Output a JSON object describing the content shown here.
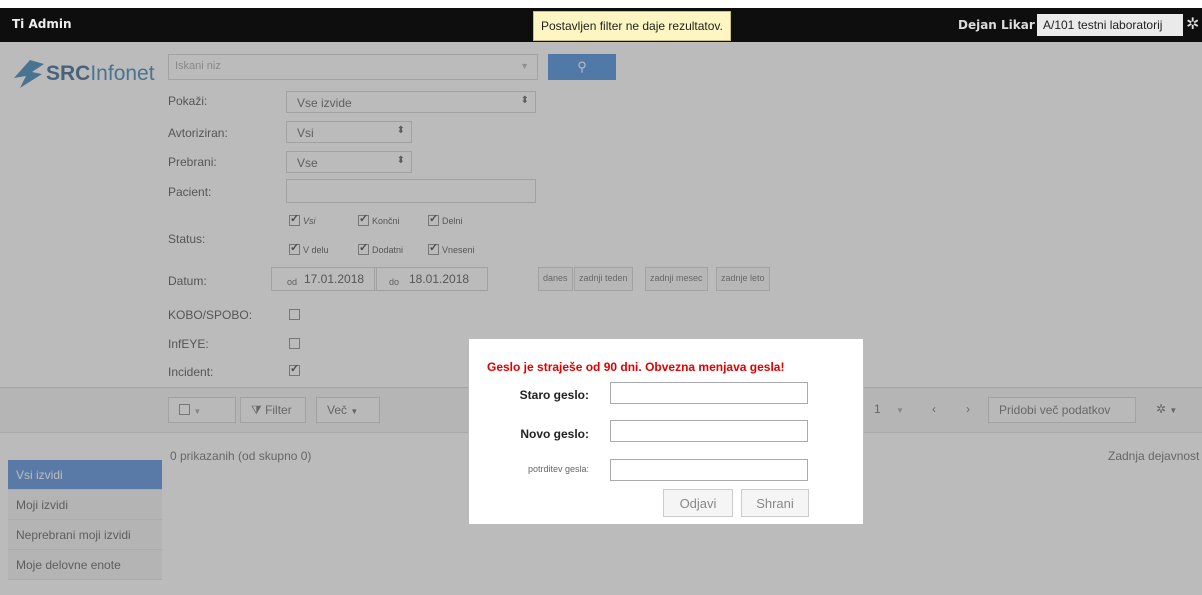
{
  "topbar": {
    "brand": "Ti  Admin",
    "user": "Dejan Likar",
    "lab": "A/101 testni laboratorij",
    "gear_icon": "gear-icon"
  },
  "tooltip": "Postavljen filter ne daje rezultatov.",
  "logo": {
    "strong": "SRC",
    "rest": "Infonet"
  },
  "search": {
    "placeholder": "Iskani niz",
    "button_icon": "search-icon"
  },
  "filters": {
    "pokazi": {
      "label": "Pokaži:",
      "value": "Vse izvide"
    },
    "avtoriziran": {
      "label": "Avtoriziran:",
      "value": "Vsi"
    },
    "prebrani": {
      "label": "Prebrani:",
      "value": "Vse"
    },
    "pacient": {
      "label": "Pacient:",
      "value": ""
    },
    "status": {
      "label": "Status:",
      "options": [
        {
          "label": "Vsi",
          "checked": true
        },
        {
          "label": "Končni",
          "checked": true
        },
        {
          "label": "Delni",
          "checked": true
        },
        {
          "label": "V delu",
          "checked": true
        },
        {
          "label": "Dodatni",
          "checked": true
        },
        {
          "label": "Vneseni",
          "checked": true
        }
      ]
    },
    "datum": {
      "label": "Datum:",
      "od_label": "od",
      "od_value": "17.01.2018",
      "do_label": "do",
      "do_value": "18.01.2018",
      "quick": [
        "danes",
        "zadnji teden",
        "zadnji mesec",
        "zadnje leto"
      ]
    },
    "kobo": {
      "label": "KOBO/SPOBO:",
      "checked": false
    },
    "infeye": {
      "label": "InfEYE:",
      "checked": false
    },
    "incident": {
      "label": "Incident:",
      "checked": true
    }
  },
  "toolbar": {
    "filter_label": "Filter",
    "vec_label": "Več",
    "page": "1",
    "more_label": "Pridobi več podatkov"
  },
  "results": {
    "count": "0 prikazanih (od skupno 0)",
    "activity": "Zadnja dejavnost"
  },
  "sidenav": [
    {
      "label": "Vsi izvidi",
      "active": true
    },
    {
      "label": "Moji izvidi",
      "active": false
    },
    {
      "label": "Neprebrani moji izvidi",
      "active": false
    },
    {
      "label": "Moje delovne enote",
      "active": false
    }
  ],
  "modal": {
    "title": "Geslo je straješe od 90 dni. Obvezna menjava gesla!",
    "old_label": "Staro geslo:",
    "new_label": "Novo geslo:",
    "confirm_label": "potrditev gesla:",
    "logout_label": "Odjavi",
    "save_label": "Shrani"
  }
}
